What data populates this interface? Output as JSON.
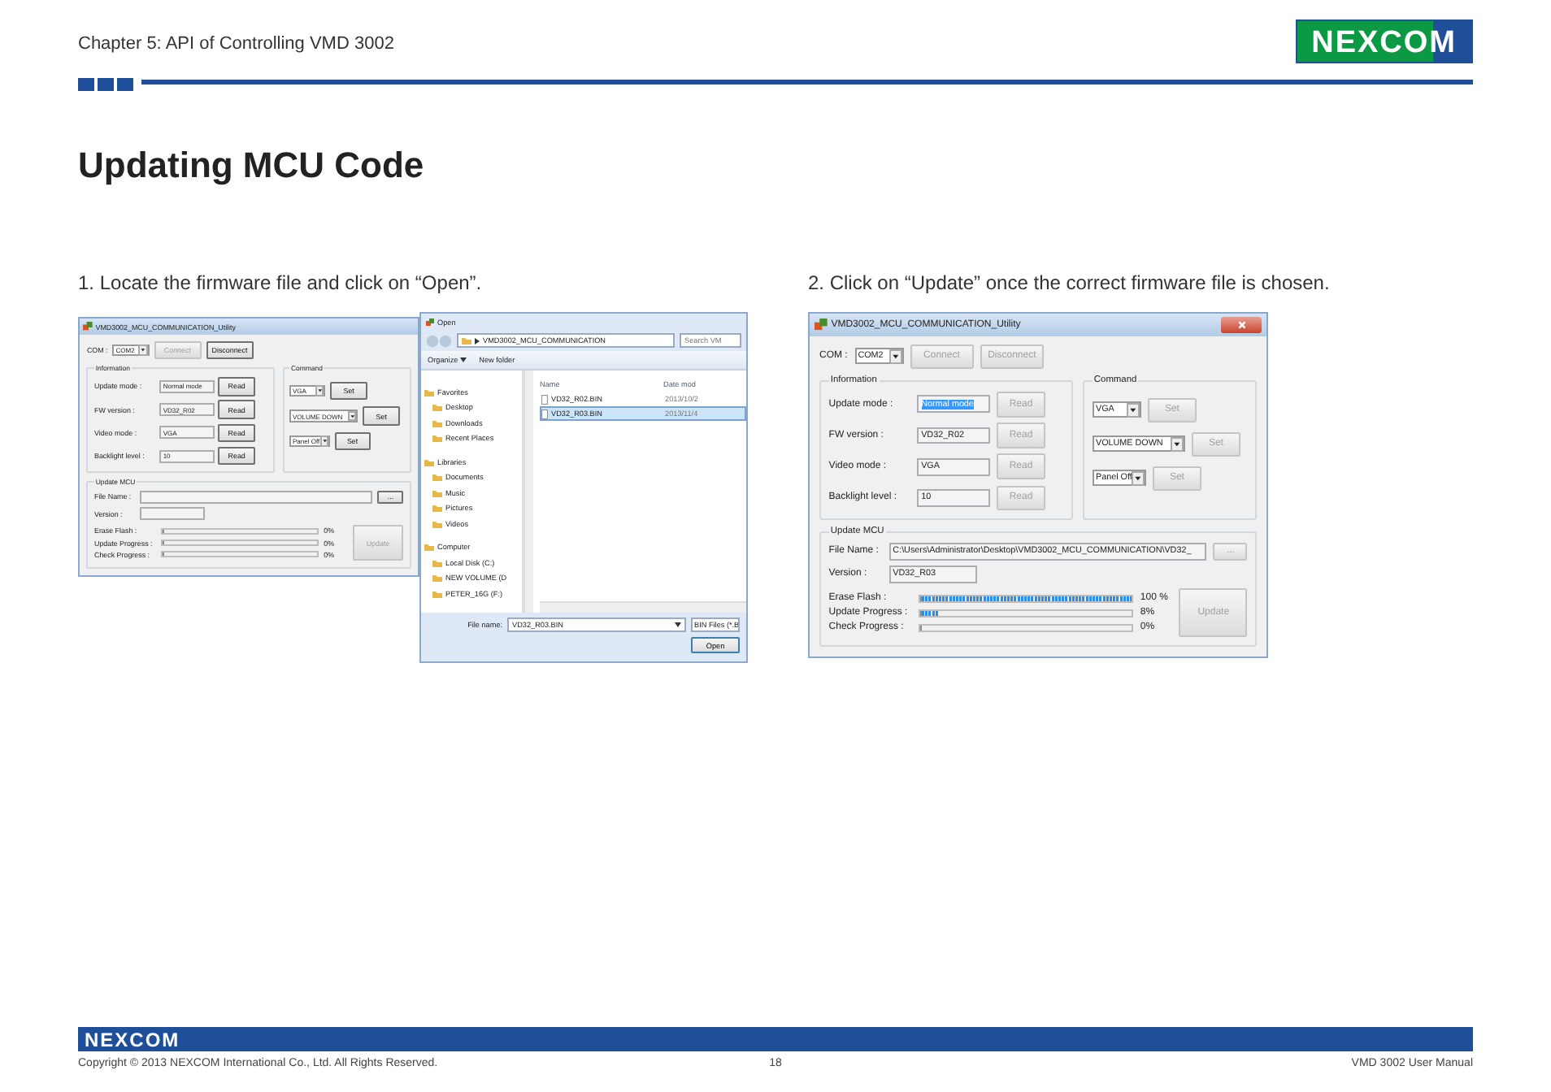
{
  "header": {
    "chapter": "Chapter 5: API of Controlling VMD 3002",
    "logo": "NEXCOM"
  },
  "title": "Updating MCU Code",
  "steps": [
    {
      "caption": "1. Locate the firmware file and click on “Open”.",
      "utility": {
        "title": "VMD3002_MCU_COMMUNICATION_Utility",
        "show_close": false,
        "com_label": "COM :",
        "com_value": "COM2",
        "com_buttons": [
          {
            "label": "Connect",
            "disabled": true
          },
          {
            "label": "Disconnect",
            "disabled": false
          }
        ],
        "information": {
          "label": "Information",
          "rows": [
            {
              "label": "Update mode :",
              "value": "Normal mode",
              "highlighted": false,
              "button": {
                "label": "Read",
                "disabled": false
              }
            },
            {
              "label": "FW version :",
              "value": "VD32_R02",
              "highlighted": false,
              "button": {
                "label": "Read",
                "disabled": false
              }
            },
            {
              "label": "Video mode :",
              "value": "VGA",
              "highlighted": false,
              "button": {
                "label": "Read",
                "disabled": false
              }
            },
            {
              "label": "Backlight level :",
              "value": "10",
              "highlighted": false,
              "button": {
                "label": "Read",
                "disabled": false
              }
            }
          ]
        },
        "command": {
          "label": "Command",
          "rows": [
            {
              "value": "VGA",
              "button": {
                "label": "Set",
                "disabled": false
              }
            },
            {
              "value": "VOLUME DOWN",
              "button": {
                "label": "Set",
                "disabled": false
              }
            },
            {
              "value": "Panel Off",
              "button": {
                "label": "Set",
                "disabled": false
              }
            }
          ]
        },
        "update": {
          "label": "Update MCU",
          "file_label": "File Name :",
          "browse": {
            "label": "...",
            "disabled": false
          },
          "version_label": "Version :",
          "progress": [
            {
              "label": "Erase Flash :",
              "level": 0,
              "reading": "0%"
            },
            {
              "label": "Update Progress :",
              "level": 0,
              "reading": "0%"
            },
            {
              "label": "Check Progress :",
              "level": 0,
              "reading": "0%"
            }
          ],
          "button": {
            "label": "Update",
            "disabled": true
          }
        }
      },
      "dialog": {
        "title": "Open",
        "path": "VMD3002_MCU_COMMUNICATION",
        "search_placeholder": "Search VM",
        "toolbar": [
          "Organize",
          "New folder"
        ],
        "nav": [
          {
            "label": "Favorites",
            "children": [
              {
                "label": "Desktop"
              },
              {
                "label": "Downloads"
              },
              {
                "label": "Recent Places"
              }
            ]
          },
          {
            "label": "Libraries",
            "children": [
              {
                "label": "Documents"
              },
              {
                "label": "Music"
              },
              {
                "label": "Pictures"
              },
              {
                "label": "Videos"
              }
            ]
          },
          {
            "label": "Computer",
            "children": [
              {
                "label": "Local Disk (C:)"
              },
              {
                "label": "NEW VOLUME (D"
              },
              {
                "label": "PETER_16G (F:)"
              }
            ]
          }
        ],
        "columns": [
          "Name",
          "Date mod"
        ],
        "files": [
          {
            "name": "VD32_R02.BIN",
            "date": "2013/10/2",
            "selected": false
          },
          {
            "name": "VD32_R03.BIN",
            "date": "2013/11/4",
            "selected": true
          }
        ],
        "file_name_label": "File name:",
        "file_name_value": "VD32_R03.BIN",
        "filter": "BIN Files (*.B",
        "open_button": "Open"
      }
    },
    {
      "caption": "2. Click on “Update” once the correct firmware file is chosen.",
      "utility": {
        "title": "VMD3002_MCU_COMMUNICATION_Utility",
        "show_close": true,
        "com_label": "COM :",
        "com_value": "COM2",
        "com_buttons": [
          {
            "label": "Connect",
            "disabled": true
          },
          {
            "label": "Disconnect",
            "disabled": true
          }
        ],
        "information": {
          "label": "Information",
          "rows": [
            {
              "label": "Update mode :",
              "value": "Normal mode",
              "highlighted": true,
              "button": {
                "label": "Read",
                "disabled": true
              }
            },
            {
              "label": "FW version :",
              "value": "VD32_R02",
              "highlighted": false,
              "button": {
                "label": "Read",
                "disabled": true
              }
            },
            {
              "label": "Video mode :",
              "value": "VGA",
              "highlighted": false,
              "button": {
                "label": "Read",
                "disabled": true
              }
            },
            {
              "label": "Backlight level :",
              "value": "10",
              "highlighted": false,
              "button": {
                "label": "Read",
                "disabled": true
              }
            }
          ]
        },
        "command": {
          "label": "Command",
          "rows": [
            {
              "value": "VGA",
              "button": {
                "label": "Set",
                "disabled": true
              }
            },
            {
              "value": "VOLUME DOWN",
              "button": {
                "label": "Set",
                "disabled": true
              }
            },
            {
              "value": "Panel Off",
              "button": {
                "label": "Set",
                "disabled": true
              }
            }
          ]
        },
        "update": {
          "label": "Update MCU",
          "file_label": "File Name :",
          "file_value": "C:\\Users\\Administrator\\Desktop\\VMD3002_MCU_COMMUNICATION\\VD32_",
          "browse": {
            "label": "...",
            "disabled": true
          },
          "version_label": "Version :",
          "version_value": "VD32_R03",
          "progress": [
            {
              "label": "Erase Flash :",
              "level": 1,
              "reading": "100 %"
            },
            {
              "label": "Update Progress :",
              "level": 0.08,
              "reading": "8%"
            },
            {
              "label": "Check Progress :",
              "level": 0,
              "reading": "0%"
            }
          ],
          "button": {
            "label": "Update",
            "disabled": true
          }
        }
      }
    }
  ],
  "footer": {
    "logo": "NEXCOM",
    "copyright": "Copyright © 2013 NEXCOM International Co., Ltd. All Rights Reserved.",
    "page": "18",
    "manual": "VMD 3002 User Manual"
  }
}
